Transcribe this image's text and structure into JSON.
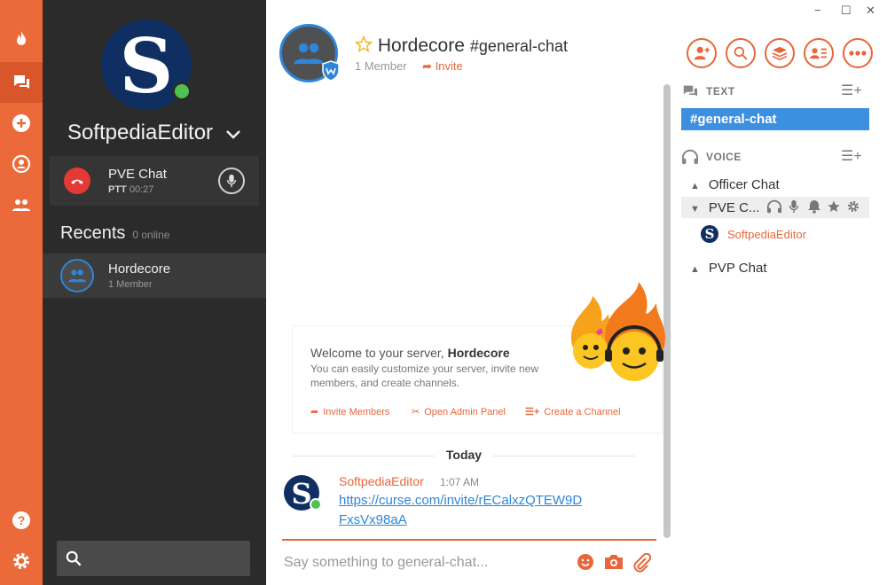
{
  "sidebar": {
    "username": "SoftpediaEditor",
    "voice": {
      "title": "PVE Chat",
      "mode": "PTT",
      "timer": "00:27"
    },
    "recents": {
      "label": "Recents",
      "online": "0 online"
    },
    "recent_items": [
      {
        "title": "Hordecore",
        "subtitle": "1 Member"
      }
    ]
  },
  "header": {
    "server_name": "Hordecore",
    "channel": "#general-chat",
    "members": "1 Member",
    "invite": "Invite"
  },
  "window_controls": {
    "minimize": "−",
    "maximize": "☐",
    "close": "✕"
  },
  "welcome": {
    "prefix": "Welcome to your server, ",
    "server": "Hordecore",
    "body": "You can easily customize your server, invite new members, and create channels.",
    "actions": {
      "invite": "Invite Members",
      "admin": "Open Admin Panel",
      "channel": "Create a Channel"
    }
  },
  "chat": {
    "day": "Today",
    "messages": [
      {
        "author": "SoftpediaEditor",
        "time": "1:07 AM",
        "text": "https://curse.com/invite/rECalxzQTEW9DFxsVx98aA"
      }
    ],
    "input_placeholder": "Say something to general-chat..."
  },
  "channels": {
    "text_label": "TEXT",
    "text_channels": [
      "#general-chat"
    ],
    "voice_label": "VOICE",
    "voice_channels": [
      {
        "name": "Officer Chat"
      },
      {
        "name": "PVE C...",
        "users": [
          "SoftpediaEditor"
        ]
      },
      {
        "name": "PVP Chat"
      }
    ]
  },
  "colors": {
    "accent": "#ec6a39",
    "sidebar": "#2b2b2b",
    "link": "#2d86d7",
    "online": "#4ec14f",
    "active_channel": "#3d8fe0"
  },
  "icons": {
    "rail": [
      "flame-icon",
      "chat-icon",
      "add-icon",
      "friends-sync-icon",
      "group-icon",
      "help-icon",
      "settings-icon"
    ],
    "header_buttons": [
      "add-user-icon",
      "search-icon",
      "layers-icon",
      "member-list-icon",
      "more-icon"
    ]
  }
}
